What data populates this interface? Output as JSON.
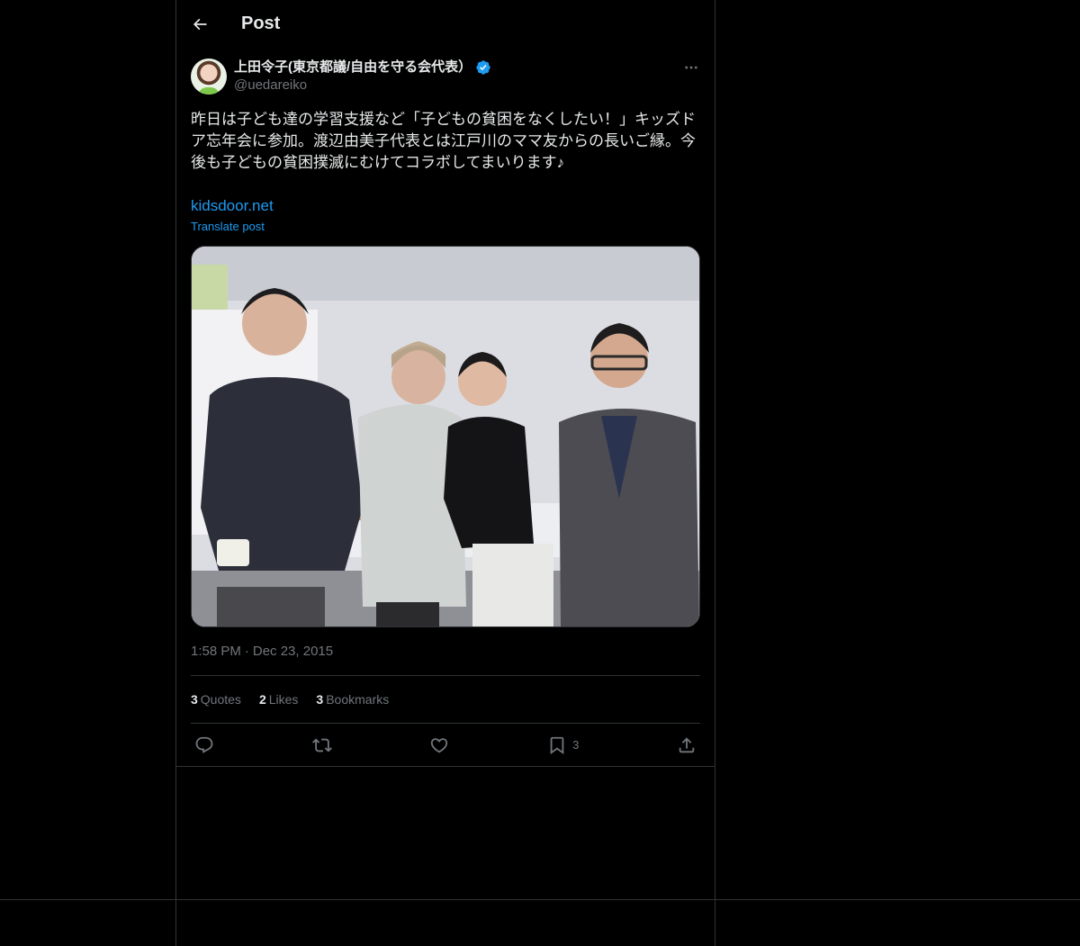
{
  "header": {
    "title": "Post",
    "back_icon": "arrow-left-icon"
  },
  "post": {
    "author_name": "上田令子(東京都議/自由を守る会代表）",
    "handle": "@uedareiko",
    "verified": true,
    "text": "昨日は子ども達の学習支援など「子どもの貧困をなくしたい！」キッズドア忘年会に参加。渡辺由美子代表とは江戸川のママ友からの長いご縁。今後も子どもの貧困撲滅にむけてコラボしてまいります♪",
    "link": "kidsdoor.net",
    "translate_label": "Translate post",
    "time": "1:58 PM",
    "date": "Dec 23, 2015"
  },
  "stats": {
    "quotes_count": "3",
    "quotes_label": "Quotes",
    "likes_count": "2",
    "likes_label": "Likes",
    "bookmarks_count": "3",
    "bookmarks_label": "Bookmarks"
  },
  "actions": {
    "reply_icon": "reply-icon",
    "repost_icon": "repost-icon",
    "like_icon": "heart-icon",
    "bookmark_icon": "bookmark-icon",
    "bookmark_count": "3",
    "share_icon": "share-icon"
  },
  "colors": {
    "background": "#000000",
    "accent": "#1d9bf0",
    "muted": "#71767b",
    "border": "#2f3336"
  }
}
